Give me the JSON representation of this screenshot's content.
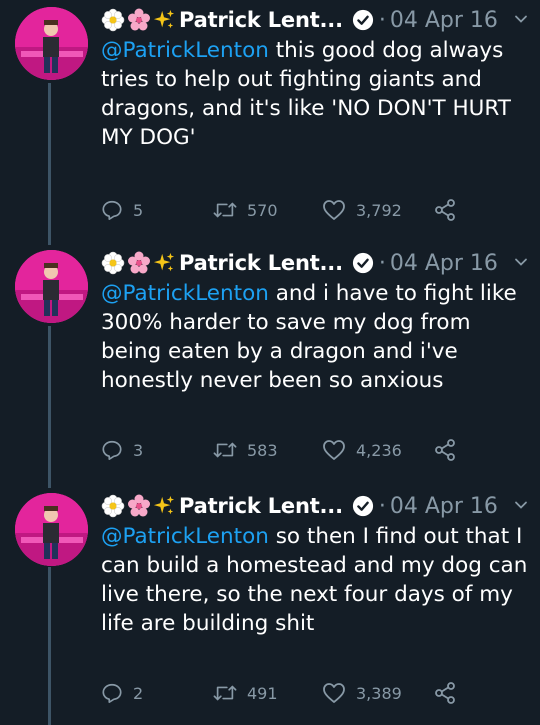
{
  "tweets": [
    {
      "name": "Patrick Lent...",
      "date": "04 Apr 16",
      "mention": "@PatrickLenton",
      "text": " this good dog always tries to help out fighting giants and dragons, and it's like 'NO DON'T HURT MY DOG'",
      "replies": "5",
      "retweets": "570",
      "likes": "3,792"
    },
    {
      "name": "Patrick Lent...",
      "date": "04 Apr 16",
      "mention": "@PatrickLenton",
      "text": " and i have to fight like 300% harder to save my dog from being eaten by a dragon and i've honestly never been so anxious",
      "replies": "3",
      "retweets": "583",
      "likes": "4,236"
    },
    {
      "name": "Patrick Lent...",
      "date": "04 Apr 16",
      "mention": "@PatrickLenton",
      "text": " so then I find out that I can build a homestead and my dog can live there, so the next four days of my life are building shit",
      "replies": "2",
      "retweets": "491",
      "likes": "3,389"
    }
  ],
  "separator": "·",
  "icons": {
    "emoji": [
      "white-flower-icon",
      "cherry-blossom-icon",
      "sparkles-icon"
    ],
    "verified": "verified-badge-icon",
    "menu": "chevron-down-icon",
    "reply": "reply-icon",
    "retweet": "retweet-icon",
    "like": "heart-icon",
    "share": "share-icon"
  },
  "colors": {
    "background": "#141d26",
    "mention": "#1da1f2",
    "muted": "#8899a6",
    "thread_line": "#3d5466",
    "avatar_bg": "#e0249a"
  }
}
